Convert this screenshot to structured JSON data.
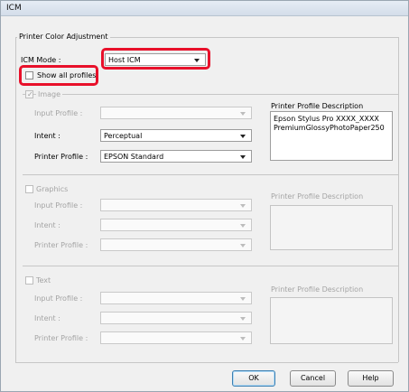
{
  "window": {
    "title": "ICM"
  },
  "section_title": "Printer Color Adjustment",
  "icm_mode": {
    "label": "ICM Mode :",
    "value": "Host ICM"
  },
  "show_all_profiles": {
    "label": "Show all profiles",
    "checked": false
  },
  "image": {
    "label": "Image",
    "checked": true,
    "input_profile_label": "Input Profile :",
    "input_profile_value": "",
    "intent_label": "Intent :",
    "intent_value": "Perceptual",
    "printer_profile_label": "Printer Profile :",
    "printer_profile_value": "EPSON Standard",
    "description_label": "Printer Profile Description",
    "description_line1": "Epson Stylus Pro XXXX_XXXX",
    "description_line2": "PremiumGlossyPhotoPaper250"
  },
  "graphics": {
    "label": "Graphics",
    "checked": false,
    "input_profile_label": "Input Profile :",
    "intent_label": "Intent :",
    "printer_profile_label": "Printer Profile :",
    "description_label": "Printer Profile Description"
  },
  "text": {
    "label": "Text",
    "checked": false,
    "input_profile_label": "Input Profile :",
    "intent_label": "Intent :",
    "printer_profile_label": "Printer Profile :",
    "description_label": "Printer Profile Description"
  },
  "buttons": {
    "ok": "OK",
    "cancel": "Cancel",
    "help": "Help"
  },
  "colors": {
    "highlight": "#e8102a",
    "default_button_border": "#3c7fb1"
  }
}
